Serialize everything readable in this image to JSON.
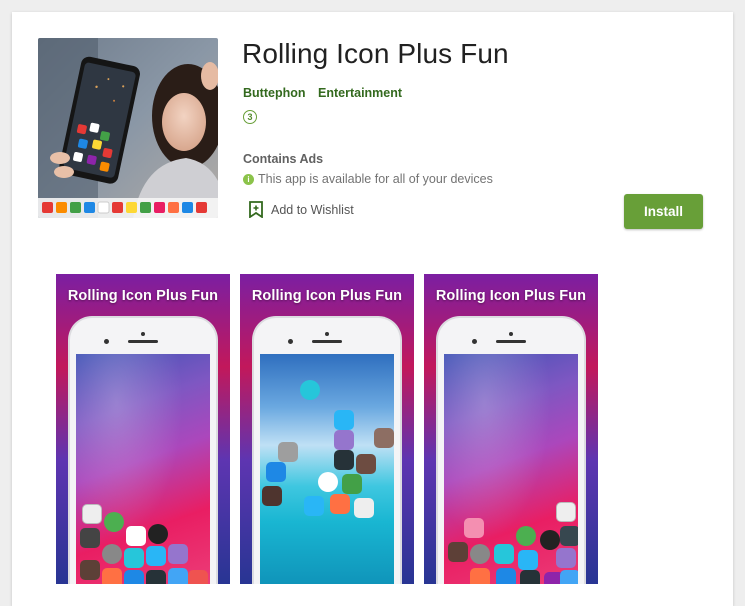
{
  "app": {
    "title": "Rolling Icon Plus Fun",
    "developer": "Buttephon",
    "category": "Entertainment",
    "rating_badge": "3",
    "contains_ads": "Contains Ads",
    "availability": "This app is available for all of your devices",
    "wishlist_label": "Add to Wishlist",
    "install_label": "Install"
  },
  "screenshots": [
    {
      "title": "Rolling Icon Plus Fun",
      "wallpaper": "purple"
    },
    {
      "title": "Rolling Icon Plus Fun",
      "wallpaper": "sea"
    },
    {
      "title": "Rolling Icon Plus Fun",
      "wallpaper": "purple"
    }
  ],
  "colors": {
    "accent": "#689f38",
    "link": "#33691e",
    "title": "#212121"
  }
}
